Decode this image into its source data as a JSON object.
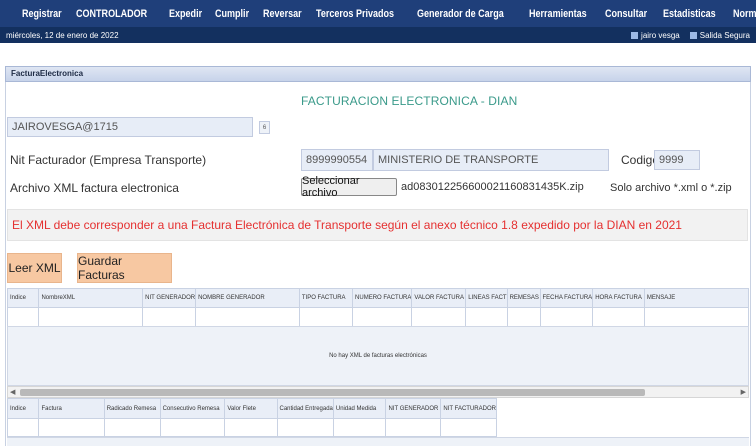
{
  "nav": {
    "items": [
      "Registrar",
      "CONTROLADOR",
      "Expedir",
      "Cumplir",
      "Reversar",
      "Terceros Privados",
      "Generador de Carga",
      "Herramientas",
      "Consultar",
      "Estadisticas",
      "Normatividad"
    ]
  },
  "subbar": {
    "date": "miércoles, 12 de enero de 2022",
    "user": "jairo vesga",
    "logout": "Salida Segura"
  },
  "panel": {
    "header": "FacturaElectronica",
    "title": "FACTURACION ELECTRONICA - DIAN"
  },
  "form": {
    "username": "JAIROVESGA@1715",
    "user_badge": "6",
    "nit_label": "Nit Facturador (Empresa Transporte)",
    "nit_value": "8999990554",
    "nit_name": "MINISTERIO DE TRANSPORTE",
    "codigo_label": "Codigo",
    "codigo_value": "9999",
    "xml_label": "Archivo XML factura electronica",
    "file_button": "Seleccionar archivo",
    "file_name": "ad08301225660002116083143​5K.zip",
    "file_hint": "Solo archivo *.xml o *.zip"
  },
  "alert": "El XML debe corresponder a una Factura Electrónica de Transporte según el anexo técnico 1.8 expedido por la DIAN en 2021",
  "buttons": {
    "leer": "Leer XML",
    "guardar": "Guardar Facturas"
  },
  "table1": {
    "headers": [
      "Indice",
      "NombreXML",
      "NIT GENERADOR",
      "NOMBRE GENERADOR",
      "TIPO FACTURA",
      "NUMERO FACTURA",
      "VALOR FACTURA",
      "LINEAS FACT",
      "REMESAS",
      "FECHA FACTURA",
      "HORA FACTURA",
      "MENSAJE"
    ],
    "empty": "No hay XML de facturas electrónicas"
  },
  "table2": {
    "headers": [
      "Indice",
      "Factura",
      "Radicado Remesa",
      "Consecutivo Remesa",
      "Valor Flete",
      "Cantidad Entregada",
      "Unidad Medida",
      "NIT GENERADOR",
      "NIT FACTURADOR"
    ]
  },
  "colors": {
    "nav": "#1f3f7a",
    "accent_button": "#f7c8a2",
    "alert_text": "#e53030",
    "title": "#3a9a8a"
  }
}
